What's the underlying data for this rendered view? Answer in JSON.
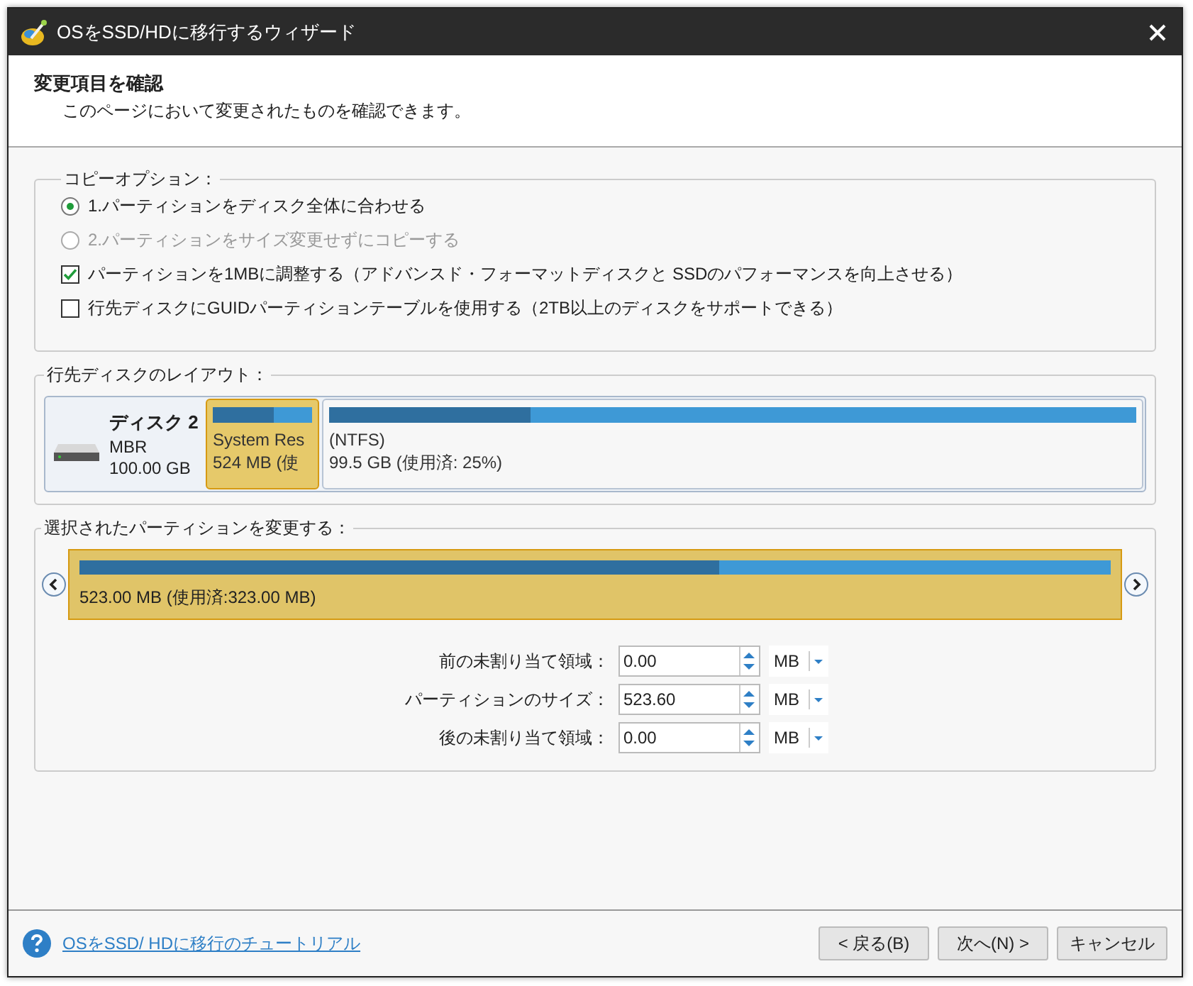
{
  "window": {
    "title": "OSをSSD/HDに移行するウィザード"
  },
  "header": {
    "title": "変更項目を確認",
    "subtitle": "このページにおいて変更されたものを確認できます。"
  },
  "copy_options": {
    "legend": "コピーオプション：",
    "options": [
      {
        "kind": "radio",
        "label": "1.パーティションをディスク全体に合わせる",
        "selected": true,
        "disabled": false
      },
      {
        "kind": "radio",
        "label": "2.パーティションをサイズ変更せずにコピーする",
        "selected": false,
        "disabled": true
      },
      {
        "kind": "checkbox",
        "label": "パーティションを1MBに調整する（アドバンスド・フォーマットディスクと SSDのパフォーマンスを向上させる）",
        "checked": true,
        "disabled": false
      },
      {
        "kind": "checkbox",
        "label": "行先ディスクにGUIDパーティションテーブルを使用する（2TB以上のディスクをサポートできる）",
        "checked": false,
        "disabled": false
      }
    ]
  },
  "disk_layout": {
    "legend": "行先ディスクのレイアウト：",
    "disk": {
      "name": "ディスク 2",
      "type": "MBR",
      "size": "100.00 GB"
    },
    "partitions": [
      {
        "label": "System Res",
        "size": "524 MB (使",
        "level": 0.62,
        "selected": true
      },
      {
        "label": "(NTFS)",
        "size": "99.5 GB (使用済: 25%)",
        "level": 0.25,
        "selected": false
      }
    ]
  },
  "resize": {
    "legend": "選択されたパーティションを変更する：",
    "bar": {
      "label": "523.00 MB (使用済:323.00 MB)",
      "level": 0.62
    },
    "fields": [
      {
        "label": "前の未割り当て領域：",
        "value": "0.00",
        "unit": "MB"
      },
      {
        "label": "パーティションのサイズ：",
        "value": "523.60",
        "unit": "MB"
      },
      {
        "label": "後の未割り当て領域：",
        "value": "0.00",
        "unit": "MB"
      }
    ]
  },
  "footer": {
    "link": "OSをSSD/ HDに移行のチュートリアル",
    "buttons": [
      "< 戻る(B)",
      "次へ(N) >",
      "キャンセル"
    ]
  }
}
